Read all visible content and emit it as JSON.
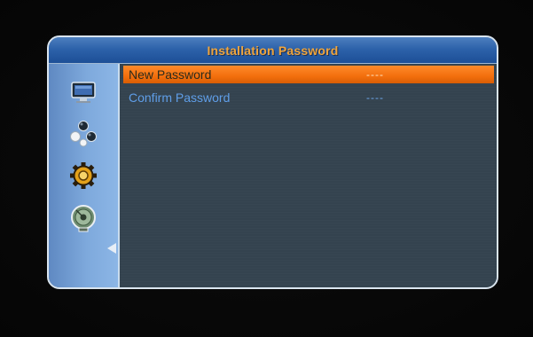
{
  "window": {
    "title": "Installation Password"
  },
  "sidebar": {
    "items": [
      {
        "icon": "tv-monitor-icon",
        "selected": false
      },
      {
        "icon": "channel-balls-icon",
        "selected": false
      },
      {
        "icon": "gear-settings-icon",
        "selected": false
      },
      {
        "icon": "satellite-dish-icon",
        "selected": true
      }
    ]
  },
  "form": {
    "fields": [
      {
        "label": "New Password",
        "value": "----",
        "selected": true
      },
      {
        "label": "Confirm Password",
        "value": "----",
        "selected": false
      }
    ]
  },
  "colors": {
    "accent": "#f36f0d",
    "title_text": "#f0a53c",
    "label_text": "#5f9ee8",
    "title_bar": "#2d62aa",
    "sidebar": "#7ea9dc",
    "content_bg": "#34434f"
  }
}
